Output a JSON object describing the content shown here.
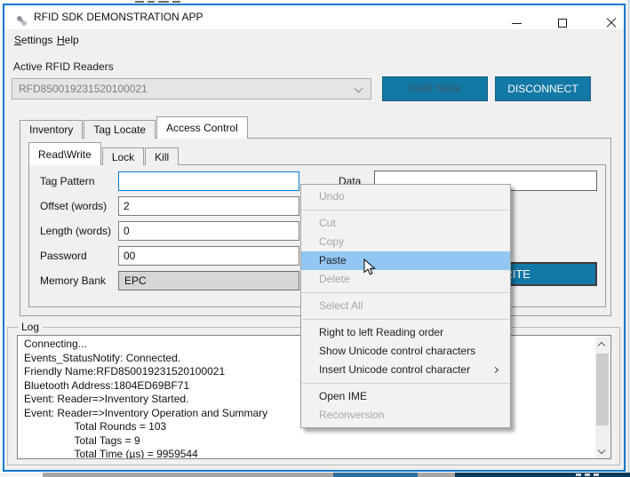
{
  "colors": {
    "accent": "#1278A6",
    "menu_highlight": "#93C7F3",
    "window_border": "#0B79D0",
    "focus_border": "#0078D7"
  },
  "titlebar": {
    "title": "RFID SDK DEMONSTRATION APP"
  },
  "menubar": {
    "items": [
      "Settings",
      "Help"
    ]
  },
  "reader_section": {
    "label": "Active RFID Readers",
    "selected_reader": "RFD850019231520100021",
    "pair_new_button": "PAIR NEW",
    "disconnect_button": "DISCONNECT"
  },
  "tabs": {
    "active": "Access Control",
    "items": [
      "Inventory",
      "Tag Locate",
      "Access Control"
    ]
  },
  "subtabs": {
    "active": "Read\\Write",
    "items": [
      "Read\\Write",
      "Lock",
      "Kill"
    ]
  },
  "form": {
    "fields": [
      {
        "label": "Tag Pattern",
        "value": ""
      },
      {
        "label": "Offset (words)",
        "value": "2"
      },
      {
        "label": "Length (words)",
        "value": "0"
      },
      {
        "label": "Password",
        "value": "00"
      },
      {
        "label": "Memory Bank",
        "value": "EPC"
      }
    ],
    "data_label": "Data",
    "data_value": "",
    "write_button": "WRITE"
  },
  "context_menu": {
    "items": [
      {
        "label": "Undo",
        "enabled": false
      },
      {
        "separator": true
      },
      {
        "label": "Cut",
        "enabled": false
      },
      {
        "label": "Copy",
        "enabled": false
      },
      {
        "label": "Paste",
        "enabled": true,
        "highlighted": true
      },
      {
        "label": "Delete",
        "enabled": false
      },
      {
        "separator": true
      },
      {
        "label": "Select All",
        "enabled": false
      },
      {
        "separator": true
      },
      {
        "label": "Right to left Reading order",
        "enabled": true
      },
      {
        "label": "Show Unicode control characters",
        "enabled": true
      },
      {
        "label": "Insert Unicode control character",
        "enabled": true,
        "submenu": true
      },
      {
        "separator": true
      },
      {
        "label": "Open IME",
        "enabled": true
      },
      {
        "label": "Reconversion",
        "enabled": false
      }
    ]
  },
  "log": {
    "label": "Log",
    "lines": [
      "Connecting...",
      "Events_StatusNotify: Connected.",
      "Friendly Name:RFD850019231520100021",
      "Bluetooth Address:1804ED69BF71",
      "Event: Reader=>Inventory Started.",
      "Event: Reader=>Inventory Operation and Summary",
      "                 Total Rounds = 103",
      "                 Total Tags = 9",
      "                 Total Time (µs) = 9959544"
    ]
  }
}
